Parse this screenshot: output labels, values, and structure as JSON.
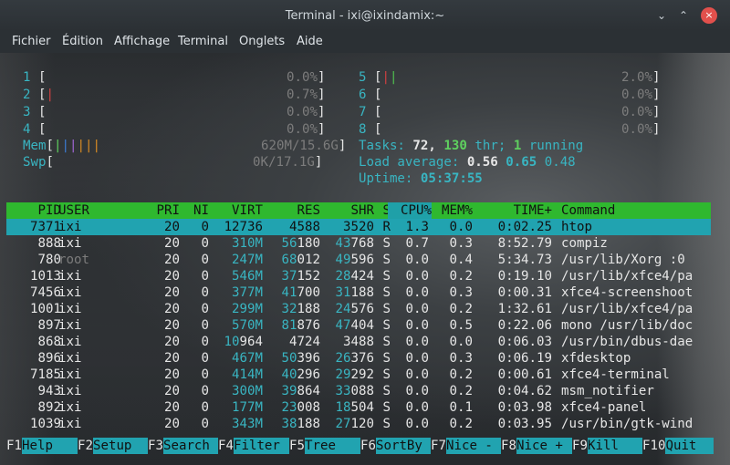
{
  "window": {
    "title": "Terminal - ixi@ixindamix:~",
    "minimize_glyph": "⌄",
    "maximize_glyph": "⌃",
    "close_glyph": "×",
    "icons": {
      "minimize": "minimize-icon",
      "maximize": "maximize-icon",
      "close": "close-icon"
    }
  },
  "menu": [
    "Fichier",
    "Édition",
    "Affichage",
    "Terminal",
    "Onglets",
    "Aide"
  ],
  "cpus_left": [
    {
      "id": "1",
      "bar": "",
      "pct": "0.0%"
    },
    {
      "id": "2",
      "bar": "|",
      "pct": "0.7%"
    },
    {
      "id": "3",
      "bar": "",
      "pct": "0.0%"
    },
    {
      "id": "4",
      "bar": "",
      "pct": "0.0%"
    }
  ],
  "cpus_right": [
    {
      "id": "5",
      "bar": "||",
      "pct": "2.0%"
    },
    {
      "id": "6",
      "bar": "",
      "pct": "0.0%"
    },
    {
      "id": "7",
      "bar": "",
      "pct": "0.0%"
    },
    {
      "id": "8",
      "bar": "",
      "pct": "0.0%"
    }
  ],
  "mem": {
    "label": "Mem",
    "bar": "||||||",
    "value": "620M/15.6G"
  },
  "swp": {
    "label": "Swp",
    "value": "0K/17.1G"
  },
  "tasks": {
    "label": "Tasks:",
    "count": "72,",
    "threads": "130",
    "thr_label": "thr;",
    "running": "1",
    "running_label": "running"
  },
  "load": {
    "label": "Load average:",
    "l1": "0.56",
    "l5": "0.65",
    "l15": "0.48"
  },
  "uptime": {
    "label": "Uptime:",
    "value": "05:37:55"
  },
  "columns": [
    "PID",
    "USER",
    "PRI",
    "NI",
    "VIRT",
    "RES",
    "SHR",
    "S",
    "CPU%",
    "MEM%",
    "TIME+",
    "Command"
  ],
  "processes": [
    {
      "pid": "7371",
      "user": "ixi",
      "pri": "20",
      "ni": "0",
      "virt": "12736",
      "res": "4588",
      "shr": "3520",
      "s": "R",
      "cpu": "1.3",
      "mem": "0.0",
      "time": "0:02.25",
      "cmd": "htop"
    },
    {
      "pid": "888",
      "user": "ixi",
      "pri": "20",
      "ni": "0",
      "virt": "310M",
      "res": "56180",
      "shr": "43768",
      "s": "S",
      "cpu": "0.7",
      "mem": "0.3",
      "time": "8:52.79",
      "cmd": "compiz"
    },
    {
      "pid": "780",
      "user": "root",
      "pri": "20",
      "ni": "0",
      "virt": "247M",
      "res": "68012",
      "shr": "49596",
      "s": "S",
      "cpu": "0.0",
      "mem": "0.4",
      "time": "5:34.73",
      "cmd": "/usr/lib/Xorg :0"
    },
    {
      "pid": "1013",
      "user": "ixi",
      "pri": "20",
      "ni": "0",
      "virt": "546M",
      "res": "37152",
      "shr": "28424",
      "s": "S",
      "cpu": "0.0",
      "mem": "0.2",
      "time": "0:19.10",
      "cmd": "/usr/lib/xfce4/pa"
    },
    {
      "pid": "7456",
      "user": "ixi",
      "pri": "20",
      "ni": "0",
      "virt": "377M",
      "res": "41700",
      "shr": "31188",
      "s": "S",
      "cpu": "0.0",
      "mem": "0.3",
      "time": "0:00.31",
      "cmd": "xfce4-screenshoot"
    },
    {
      "pid": "1001",
      "user": "ixi",
      "pri": "20",
      "ni": "0",
      "virt": "299M",
      "res": "32188",
      "shr": "24576",
      "s": "S",
      "cpu": "0.0",
      "mem": "0.2",
      "time": "1:32.61",
      "cmd": "/usr/lib/xfce4/pa"
    },
    {
      "pid": "897",
      "user": "ixi",
      "pri": "20",
      "ni": "0",
      "virt": "570M",
      "res": "81876",
      "shr": "47404",
      "s": "S",
      "cpu": "0.0",
      "mem": "0.5",
      "time": "0:22.06",
      "cmd": "mono /usr/lib/doc"
    },
    {
      "pid": "868",
      "user": "ixi",
      "pri": "20",
      "ni": "0",
      "virt": "10964",
      "res": "4724",
      "shr": "3488",
      "s": "S",
      "cpu": "0.0",
      "mem": "0.0",
      "time": "0:06.03",
      "cmd": "/usr/bin/dbus-dae"
    },
    {
      "pid": "896",
      "user": "ixi",
      "pri": "20",
      "ni": "0",
      "virt": "467M",
      "res": "50396",
      "shr": "26376",
      "s": "S",
      "cpu": "0.0",
      "mem": "0.3",
      "time": "0:06.19",
      "cmd": "xfdesktop"
    },
    {
      "pid": "7185",
      "user": "ixi",
      "pri": "20",
      "ni": "0",
      "virt": "414M",
      "res": "40296",
      "shr": "29292",
      "s": "S",
      "cpu": "0.0",
      "mem": "0.2",
      "time": "0:00.61",
      "cmd": "xfce4-terminal"
    },
    {
      "pid": "943",
      "user": "ixi",
      "pri": "20",
      "ni": "0",
      "virt": "300M",
      "res": "39864",
      "shr": "33088",
      "s": "S",
      "cpu": "0.0",
      "mem": "0.2",
      "time": "0:04.62",
      "cmd": "msm_notifier"
    },
    {
      "pid": "892",
      "user": "ixi",
      "pri": "20",
      "ni": "0",
      "virt": "177M",
      "res": "23008",
      "shr": "18504",
      "s": "S",
      "cpu": "0.0",
      "mem": "0.1",
      "time": "0:03.98",
      "cmd": "xfce4-panel"
    },
    {
      "pid": "1039",
      "user": "ixi",
      "pri": "20",
      "ni": "0",
      "virt": "343M",
      "res": "38188",
      "shr": "27120",
      "s": "S",
      "cpu": "0.0",
      "mem": "0.2",
      "time": "0:03.95",
      "cmd": "/usr/bin/gtk-wind"
    }
  ],
  "fkeys": [
    {
      "key": "F1",
      "label": "Help"
    },
    {
      "key": "F2",
      "label": "Setup"
    },
    {
      "key": "F3",
      "label": "Search"
    },
    {
      "key": "F4",
      "label": "Filter"
    },
    {
      "key": "F5",
      "label": "Tree"
    },
    {
      "key": "F6",
      "label": "SortBy"
    },
    {
      "key": "F7",
      "label": "Nice -"
    },
    {
      "key": "F8",
      "label": "Nice +"
    },
    {
      "key": "F9",
      "label": "Kill"
    },
    {
      "key": "F10",
      "label": "Quit"
    }
  ],
  "colors": {
    "header": "#2fb82f",
    "selection": "#21a3b0",
    "accent": "#39b5c2"
  }
}
